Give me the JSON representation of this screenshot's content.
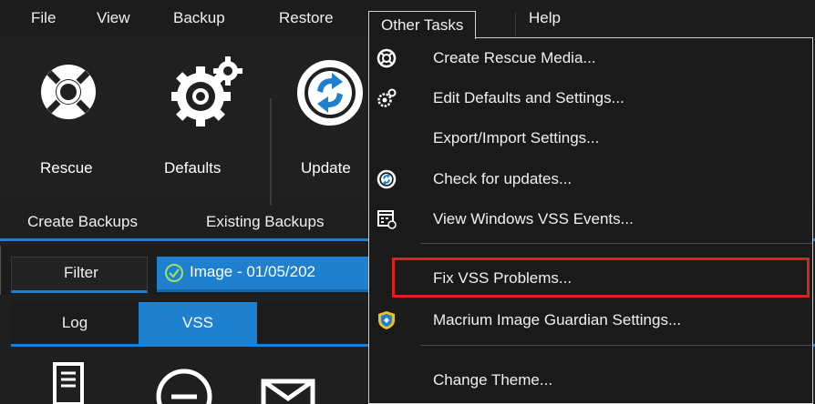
{
  "menubar": {
    "items": [
      "File",
      "View",
      "Backup",
      "Restore",
      "Other Tasks",
      "Help"
    ]
  },
  "toolbar": {
    "buttons": [
      {
        "label": "Rescue",
        "icon": "lifebuoy-icon"
      },
      {
        "label": "Defaults",
        "icon": "gears-icon"
      },
      {
        "label": "Update",
        "icon": "refresh-icon"
      }
    ]
  },
  "tabs": {
    "primary": [
      "Create Backups",
      "Existing Backups"
    ],
    "filter_label": "Filter",
    "image_label": "Image -  01/05/202",
    "secondary": [
      "Log",
      "VSS"
    ],
    "secondary_selected": "VSS"
  },
  "dropdown": {
    "items": [
      {
        "label": "Create Rescue Media...",
        "icon": "lifebuoy-icon"
      },
      {
        "label": "Edit Defaults and Settings...",
        "icon": "gears-icon"
      },
      {
        "label": "Export/Import Settings...",
        "icon": ""
      },
      {
        "label": "Check for updates...",
        "icon": "refresh-icon"
      },
      {
        "label": "View Windows VSS Events...",
        "icon": "event-log-icon"
      },
      {
        "label": "Fix VSS Problems...",
        "icon": "",
        "highlighted": true
      },
      {
        "label": "Macrium Image Guardian Settings...",
        "icon": "shield-icon"
      },
      {
        "label": "Change Theme...",
        "icon": ""
      }
    ]
  },
  "colors": {
    "accent": "#1f80cf",
    "highlight_border": "#e02020",
    "background": "#1f1f1f"
  }
}
